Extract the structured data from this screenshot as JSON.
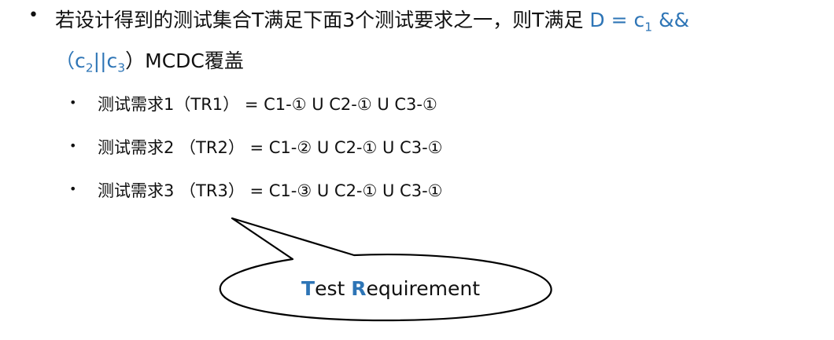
{
  "main_bullet": {
    "text_part1": "若设计得到的测试集合T满足下面3个测试要求之一，则T满足 ",
    "formula_d": "D = c",
    "formula_sub1": "1",
    "formula_and": " &&",
    "formula_open": "（",
    "formula_c2": "c",
    "formula_sub2": "2",
    "formula_or": "||c",
    "formula_sub3": "3",
    "formula_close": "）",
    "text_part2": "MCDC覆盖"
  },
  "sub_bullets": [
    {
      "text": "测试需求1（TR1） =  C1-① U C2-① U C3-①"
    },
    {
      "text": "测试需求2 （TR2） = C1-② U C2-① U C3-①"
    },
    {
      "text": "测试需求3 （TR3） = C1-③ U  C2-① U C3-①"
    }
  ],
  "callout": {
    "initial_t": "T",
    "rest_t": "est ",
    "initial_r": "R",
    "rest_r": "equirement"
  },
  "colors": {
    "accent_blue": "#2e75b6",
    "text": "#111111"
  }
}
